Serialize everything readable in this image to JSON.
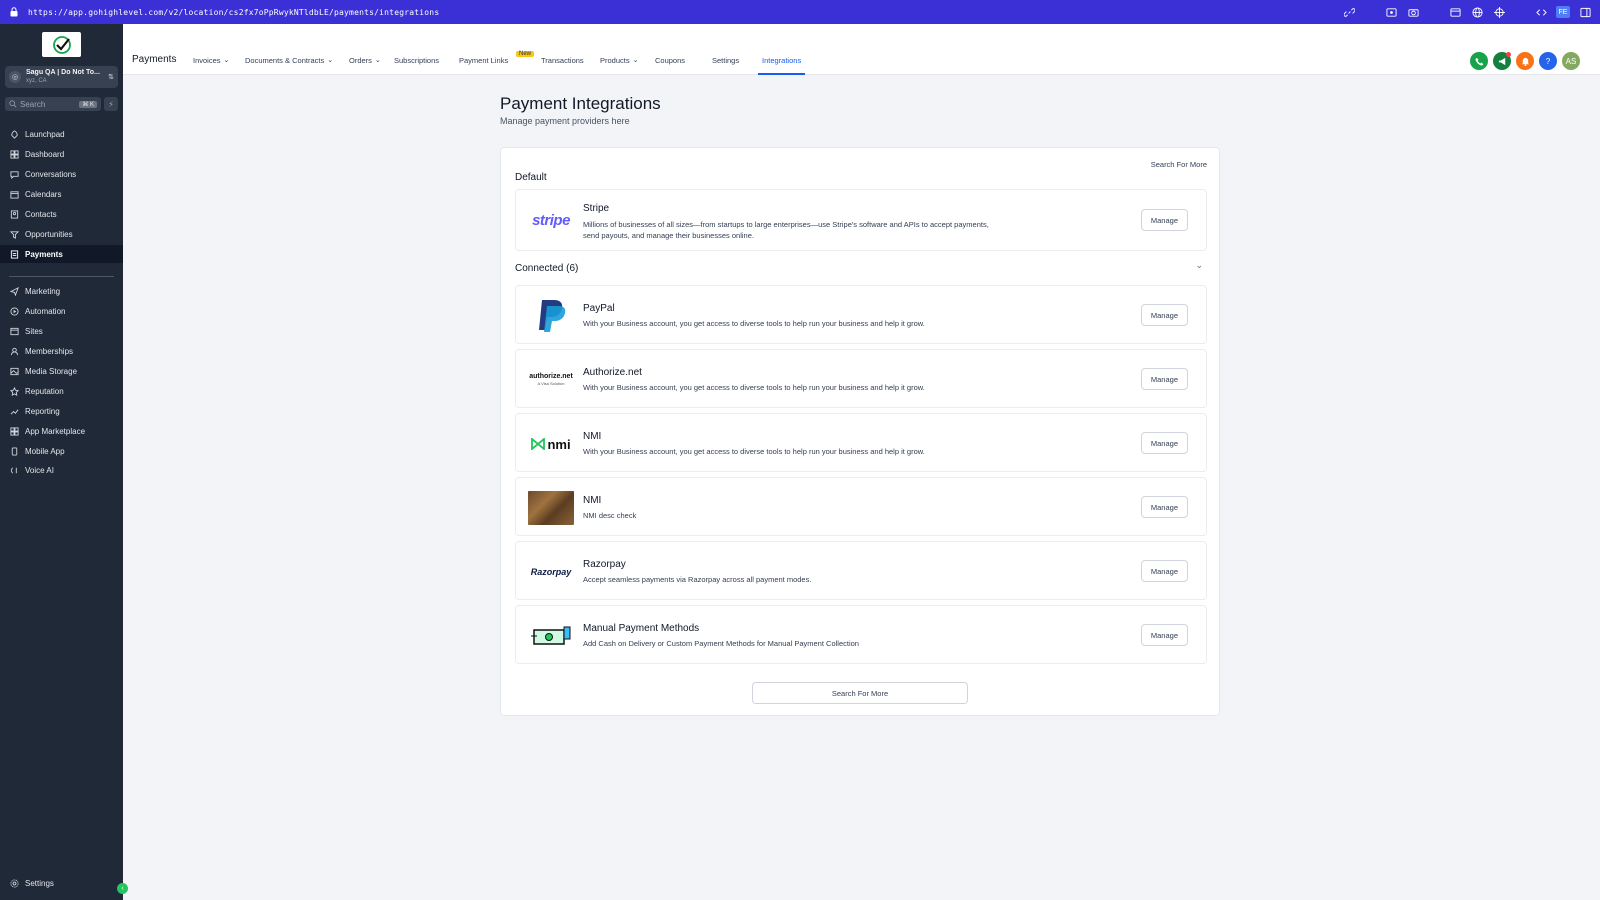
{
  "browser": {
    "url": "https://app.gohighlevel.com/v2/location/cs2fx7oPpRwykNTldbLE/payments/integrations"
  },
  "sidebar": {
    "account": {
      "name": "Sagu QA | Do Not To...",
      "location": "xyz, CA"
    },
    "search": {
      "placeholder": "Search",
      "shortcut": "⌘ K"
    },
    "items": [
      {
        "label": "Launchpad",
        "icon": "rocket-icon"
      },
      {
        "label": "Dashboard",
        "icon": "grid-icon"
      },
      {
        "label": "Conversations",
        "icon": "chat-icon"
      },
      {
        "label": "Calendars",
        "icon": "calendar-icon"
      },
      {
        "label": "Contacts",
        "icon": "contacts-icon"
      },
      {
        "label": "Opportunities",
        "icon": "filter-icon"
      },
      {
        "label": "Payments",
        "icon": "payments-icon",
        "active": true
      },
      {
        "label": "Marketing",
        "icon": "send-icon"
      },
      {
        "label": "Automation",
        "icon": "automation-icon"
      },
      {
        "label": "Sites",
        "icon": "sites-icon"
      },
      {
        "label": "Memberships",
        "icon": "membership-icon"
      },
      {
        "label": "Media Storage",
        "icon": "media-icon"
      },
      {
        "label": "Reputation",
        "icon": "star-icon"
      },
      {
        "label": "Reporting",
        "icon": "trend-icon"
      },
      {
        "label": "App Marketplace",
        "icon": "apps-icon"
      },
      {
        "label": "Mobile App",
        "icon": "phone-icon"
      },
      {
        "label": "Voice AI",
        "icon": "voice-icon"
      }
    ],
    "settings_label": "Settings"
  },
  "topnav": {
    "title": "Payments",
    "tabs": [
      {
        "label": "Invoices",
        "dropdown": true
      },
      {
        "label": "Documents & Contracts",
        "dropdown": true
      },
      {
        "label": "Orders",
        "dropdown": true
      },
      {
        "label": "Subscriptions"
      },
      {
        "label": "Payment Links",
        "badge": "New"
      },
      {
        "label": "Transactions"
      },
      {
        "label": "Products",
        "dropdown": true
      },
      {
        "label": "Coupons"
      },
      {
        "label": "Settings"
      },
      {
        "label": "Integrations",
        "active": true
      }
    ],
    "user_initials": "AS"
  },
  "main": {
    "heading": "Payment Integrations",
    "subheading": "Manage payment providers here",
    "search_more_label": "Search For More",
    "default_label": "Default",
    "connected_label": "Connected (6)",
    "manage_label": "Manage",
    "default_provider": {
      "name": "Stripe",
      "logo_text": "stripe",
      "description": "Millions of businesses of all sizes—from startups to large enterprises—use Stripe's software and APIs to accept payments, send payouts, and manage their businesses online."
    },
    "connected_providers": [
      {
        "name": "PayPal",
        "logo": "paypal",
        "description": "With your Business account, you get access to diverse tools to help run your business and help it grow."
      },
      {
        "name": "Authorize.net",
        "logo": "authorize",
        "logo_text": "authorize.net",
        "logo_sub": "A Visa Solution",
        "description": "With your Business account, you get access to diverse tools to help run your business and help it grow."
      },
      {
        "name": "NMI",
        "logo": "nmi",
        "logo_text": "nmi",
        "description": "With your Business account, you get access to diverse tools to help run your business and help it grow."
      },
      {
        "name": "NMI",
        "logo": "lion",
        "description": "NMI desc check"
      },
      {
        "name": "Razorpay",
        "logo": "razorpay",
        "logo_text": "Razorpay",
        "description": "Accept seamless payments via Razorpay across all payment modes."
      },
      {
        "name": "Manual Payment Methods",
        "logo": "cash",
        "description": "Add Cash on Delivery or Custom Payment Methods for Manual Payment Collection"
      }
    ],
    "bottom_search_label": "Search For More"
  },
  "colors": {
    "sidebar_bg": "#1f2937",
    "accent": "#155eef",
    "url_bar": "#3b2fd6",
    "stripe": "#635bff"
  }
}
